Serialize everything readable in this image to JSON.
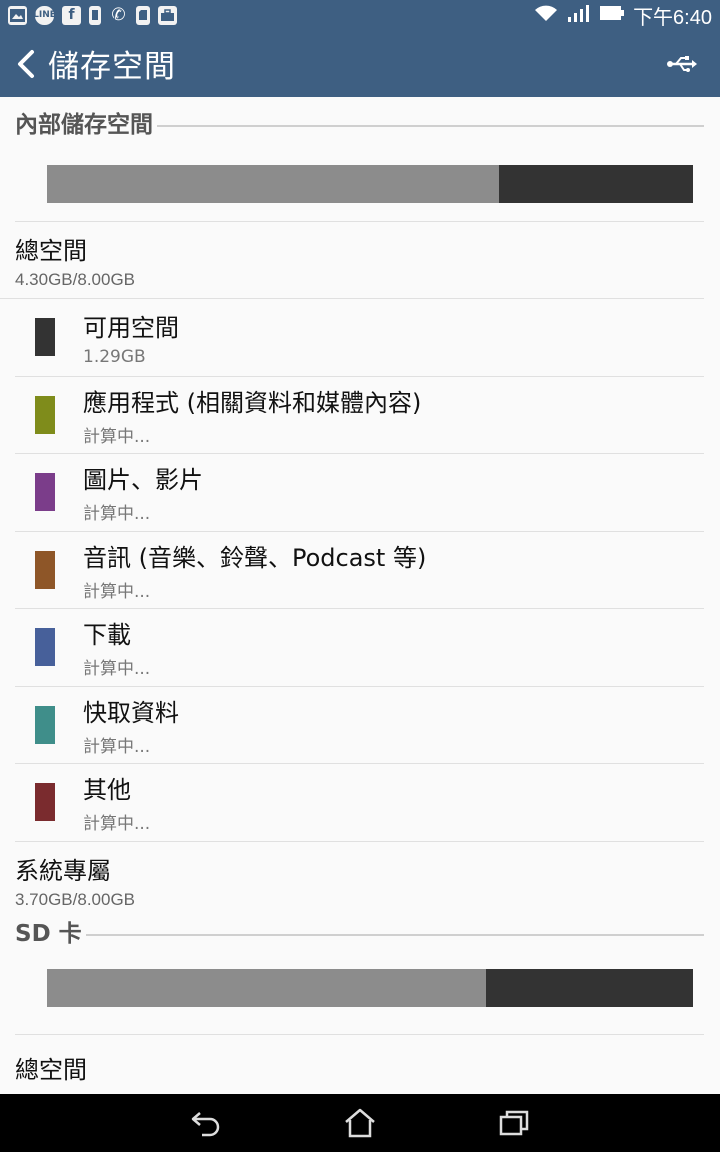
{
  "status_bar": {
    "time": "下午6:40",
    "notification_icons": [
      "gallery-icon",
      "line-icon",
      "facebook-icon",
      "phone-icon",
      "call-icon",
      "sd-card-icon",
      "briefcase-icon"
    ],
    "right_icons": [
      "wifi-icon",
      "signal-icon",
      "battery-icon"
    ]
  },
  "app_bar": {
    "title": "儲存空間",
    "back_icon": "back-chevron-icon",
    "usb_icon": "usb-icon"
  },
  "internal": {
    "header": "內部儲存空間",
    "used_fraction": 0.7,
    "total_label": "總空間",
    "total_value": "4.30GB/8.00GB",
    "categories": [
      {
        "label": "可用空間",
        "value": "1.29GB",
        "color": "#333333"
      },
      {
        "label": "應用程式 (相關資料和媒體內容)",
        "value": "計算中...",
        "color": "#7f8c1b"
      },
      {
        "label": "圖片、影片",
        "value": "計算中...",
        "color": "#7b3d8a"
      },
      {
        "label": "音訊 (音樂、鈴聲、Podcast 等)",
        "value": "計算中...",
        "color": "#8e5628"
      },
      {
        "label": "下載",
        "value": "計算中...",
        "color": "#47609a"
      },
      {
        "label": "快取資料",
        "value": "計算中...",
        "color": "#3f8e8a"
      },
      {
        "label": "其他",
        "value": "計算中...",
        "color": "#7a2b2e"
      }
    ],
    "system_label": "系統專屬",
    "system_value": "3.70GB/8.00GB"
  },
  "sd_card": {
    "header": "SD 卡",
    "used_fraction": 0.68,
    "total_label": "總空間"
  },
  "nav_bar": {
    "icons": [
      "back-icon",
      "home-icon",
      "recents-icon"
    ]
  },
  "colors": {
    "app_bar": "#3e5f82",
    "bar_used": "#8c8c8c",
    "bar_free": "#333333"
  }
}
